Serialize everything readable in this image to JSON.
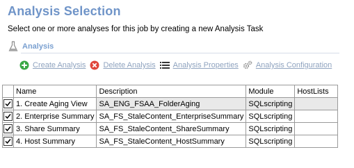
{
  "header": {
    "title": "Analysis Selection",
    "subtitle": "Select one or more analyses for this job by creating a new Analysis Task"
  },
  "section": {
    "label": "Analysis",
    "icon": "flask-icon"
  },
  "toolbar": {
    "create_label": "Create Analysis",
    "delete_label": "Delete Analysis",
    "properties_label": "Analysis Properties",
    "configuration_label": "Analysis Configuration"
  },
  "grid": {
    "columns": [
      "Name",
      "Description",
      "Module",
      "HostLists"
    ],
    "rows": [
      {
        "checked": true,
        "name": "1. Create Aging View",
        "description": "SA_ENG_FSAA_FolderAging",
        "module": "SQLscripting",
        "hostlists": ""
      },
      {
        "checked": true,
        "name": "2. Enterprise Summary",
        "description": "SA_FS_StaleContent_EnterpriseSummary",
        "module": "SQLscripting",
        "hostlists": ""
      },
      {
        "checked": true,
        "name": "3. Share Summary",
        "description": "SA_FS_StaleContent_ShareSummary",
        "module": "SQLscripting",
        "hostlists": ""
      },
      {
        "checked": true,
        "name": "4. Host Summary",
        "description": "SA_FS_StaleContent_HostSummary",
        "module": "SQLscripting",
        "hostlists": ""
      }
    ]
  },
  "colors": {
    "title": "#6f94c8",
    "link_disabled": "#8fa3bf",
    "create_icon": "#3aa845",
    "delete_icon": "#e0453a"
  }
}
